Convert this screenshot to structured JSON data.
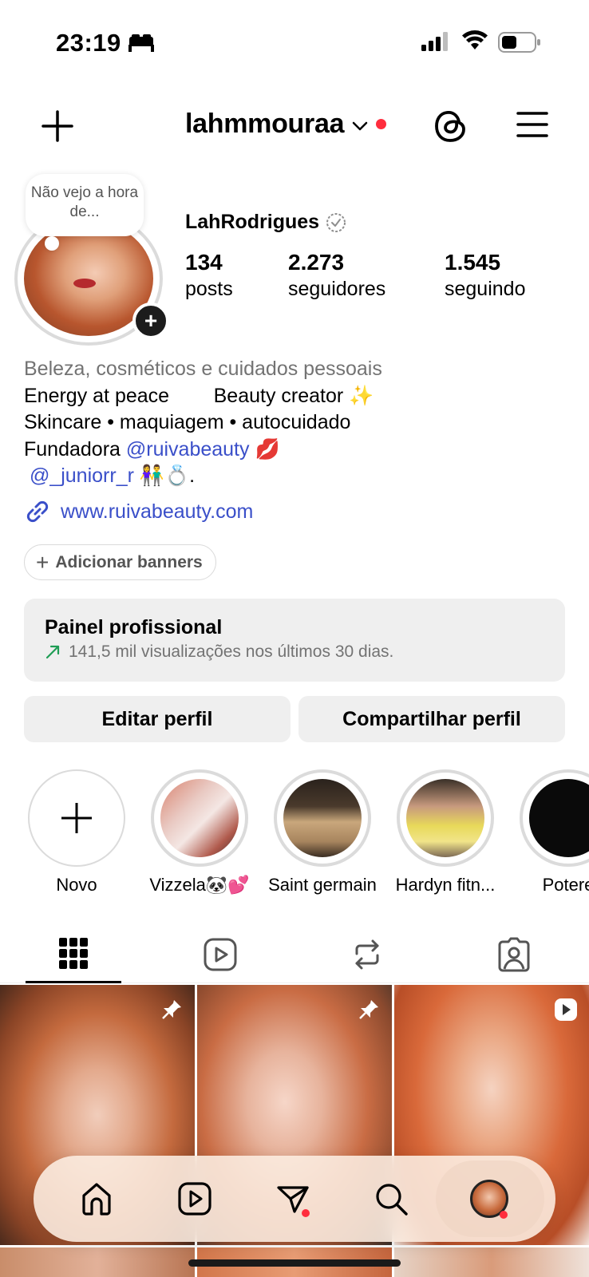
{
  "status_bar": {
    "time": "23:19",
    "icons": [
      "bed-icon",
      "cellular-signal-icon",
      "wifi-icon",
      "battery-icon"
    ]
  },
  "header": {
    "username": "lahmmouraa",
    "icons": [
      "new-post-plus-icon",
      "chevron-down-icon",
      "threads-icon",
      "menu-hamburger-icon"
    ],
    "notification_dot_color": "#ff2d3d"
  },
  "profile": {
    "note": "Não vejo a hora de...",
    "display_name": "LahRodrigues",
    "stats": [
      {
        "value": "134",
        "label": "posts"
      },
      {
        "value": "2.273",
        "label": "seguidores"
      },
      {
        "value": "1.545",
        "label": "seguindo"
      }
    ]
  },
  "bio": {
    "category": "Beleza, cosméticos e cuidados pessoais",
    "line1": "Energy at peace        Beauty creator ✨",
    "line2": "Skincare • maquiagem • autocuidado",
    "line3_prefix": "Fundadora ",
    "line3_mention": "@ruivabeauty",
    "line3_suffix": " 💋",
    "line4_mention": " @_juniorr_r",
    "line4_suffix": " 👫💍.",
    "link": "www.ruivabeauty.com",
    "mention_color": "#3a4fc9"
  },
  "add_banners_label": "Adicionar banners",
  "professional_panel": {
    "title": "Painel profissional",
    "subtitle": "141,5 mil visualizações nos últimos 30 dias.",
    "trend_icon": "trend-up-arrow-icon"
  },
  "buttons": {
    "edit_profile": "Editar perfil",
    "share_profile": "Compartilhar perfil"
  },
  "highlights": [
    {
      "label": "Novo"
    },
    {
      "label": "Vizzela🐼💕"
    },
    {
      "label": "Saint germain"
    },
    {
      "label": "Hardyn fitn..."
    },
    {
      "label": "Potere"
    }
  ],
  "tabs": [
    "grid-icon",
    "reels-icon",
    "reposts-icon",
    "tagged-icon"
  ],
  "bottom_nav": [
    "home-icon",
    "reels-icon",
    "direct-send-icon",
    "search-icon",
    "profile-avatar"
  ]
}
